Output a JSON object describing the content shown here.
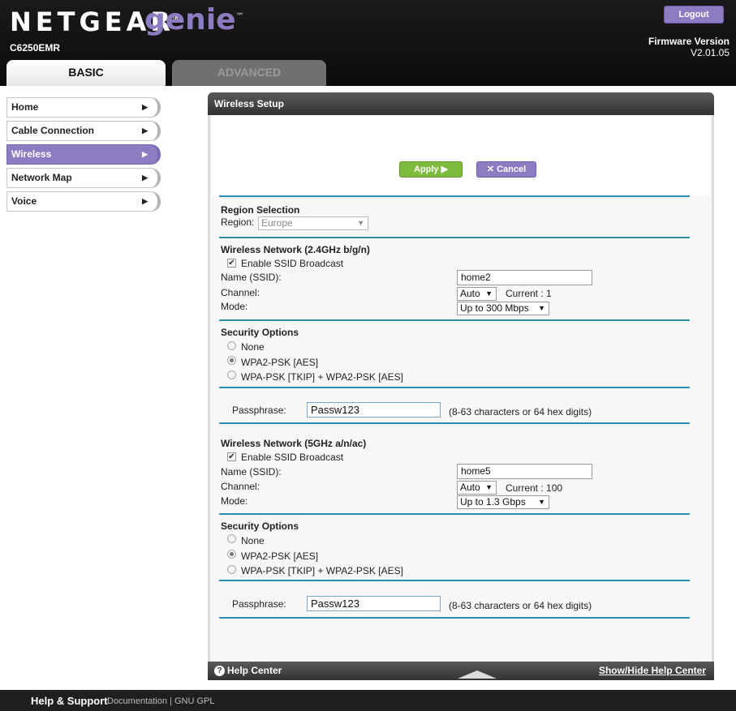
{
  "header": {
    "brand": "NETGEAR",
    "product": "genie",
    "model": "C6250EMR",
    "logout_label": "Logout",
    "firmware_label": "Firmware Version",
    "firmware_version": "V2.01.05",
    "tabs": [
      {
        "label": "BASIC",
        "active": true
      },
      {
        "label": "ADVANCED",
        "active": false
      }
    ]
  },
  "sidebar": {
    "items": [
      {
        "label": "Home",
        "active": false
      },
      {
        "label": "Cable Connection",
        "active": false
      },
      {
        "label": "Wireless",
        "active": true
      },
      {
        "label": "Network Map",
        "active": false
      },
      {
        "label": "Voice",
        "active": false
      }
    ]
  },
  "panel": {
    "title": "Wireless Setup",
    "apply_label": "Apply ▶",
    "cancel_label": "Cancel"
  },
  "region": {
    "heading": "Region Selection",
    "label": "Region:",
    "value": "Europe"
  },
  "wifi24": {
    "heading": "Wireless Network (2.4GHz b/g/n)",
    "ssid_broadcast_label": "Enable SSID Broadcast",
    "ssid_broadcast": true,
    "name_label": "Name (SSID):",
    "name_value": "home2",
    "channel_label": "Channel:",
    "channel_value": "Auto",
    "channel_current": "Current : 1",
    "mode_label": "Mode:",
    "mode_value": "Up to 300 Mbps",
    "security": {
      "heading": "Security Options",
      "options": [
        "None",
        "WPA2-PSK [AES]",
        "WPA-PSK [TKIP] + WPA2-PSK [AES]"
      ],
      "selected": "WPA2-PSK [AES]"
    },
    "passphrase_label": "Passphrase:",
    "passphrase_value": "Passw123",
    "passphrase_hint": "(8-63 characters or 64 hex digits)"
  },
  "wifi5": {
    "heading": "Wireless Network (5GHz a/n/ac)",
    "ssid_broadcast_label": "Enable SSID Broadcast",
    "ssid_broadcast": true,
    "name_label": "Name (SSID):",
    "name_value": "home5",
    "channel_label": "Channel:",
    "channel_value": "Auto",
    "channel_current": "Current : 100",
    "mode_label": "Mode:",
    "mode_value": "Up to 1.3 Gbps",
    "security": {
      "heading": "Security Options",
      "options": [
        "None",
        "WPA2-PSK [AES]",
        "WPA-PSK [TKIP] + WPA2-PSK [AES]"
      ],
      "selected": "WPA2-PSK [AES]"
    },
    "passphrase_label": "Passphrase:",
    "passphrase_value": "Passw123",
    "passphrase_hint": "(8-63 characters or 64 hex digits)"
  },
  "helpbar": {
    "title": "Help Center",
    "toggle_label": "Show/Hide Help Center"
  },
  "footer": {
    "title": "Help & Support",
    "links": "Documentation | GNU GPL"
  },
  "colors": {
    "accent_purple": "#8e7cc3",
    "apply_green": "#7dbb3e",
    "divider_blue": "#2a8fb0"
  }
}
